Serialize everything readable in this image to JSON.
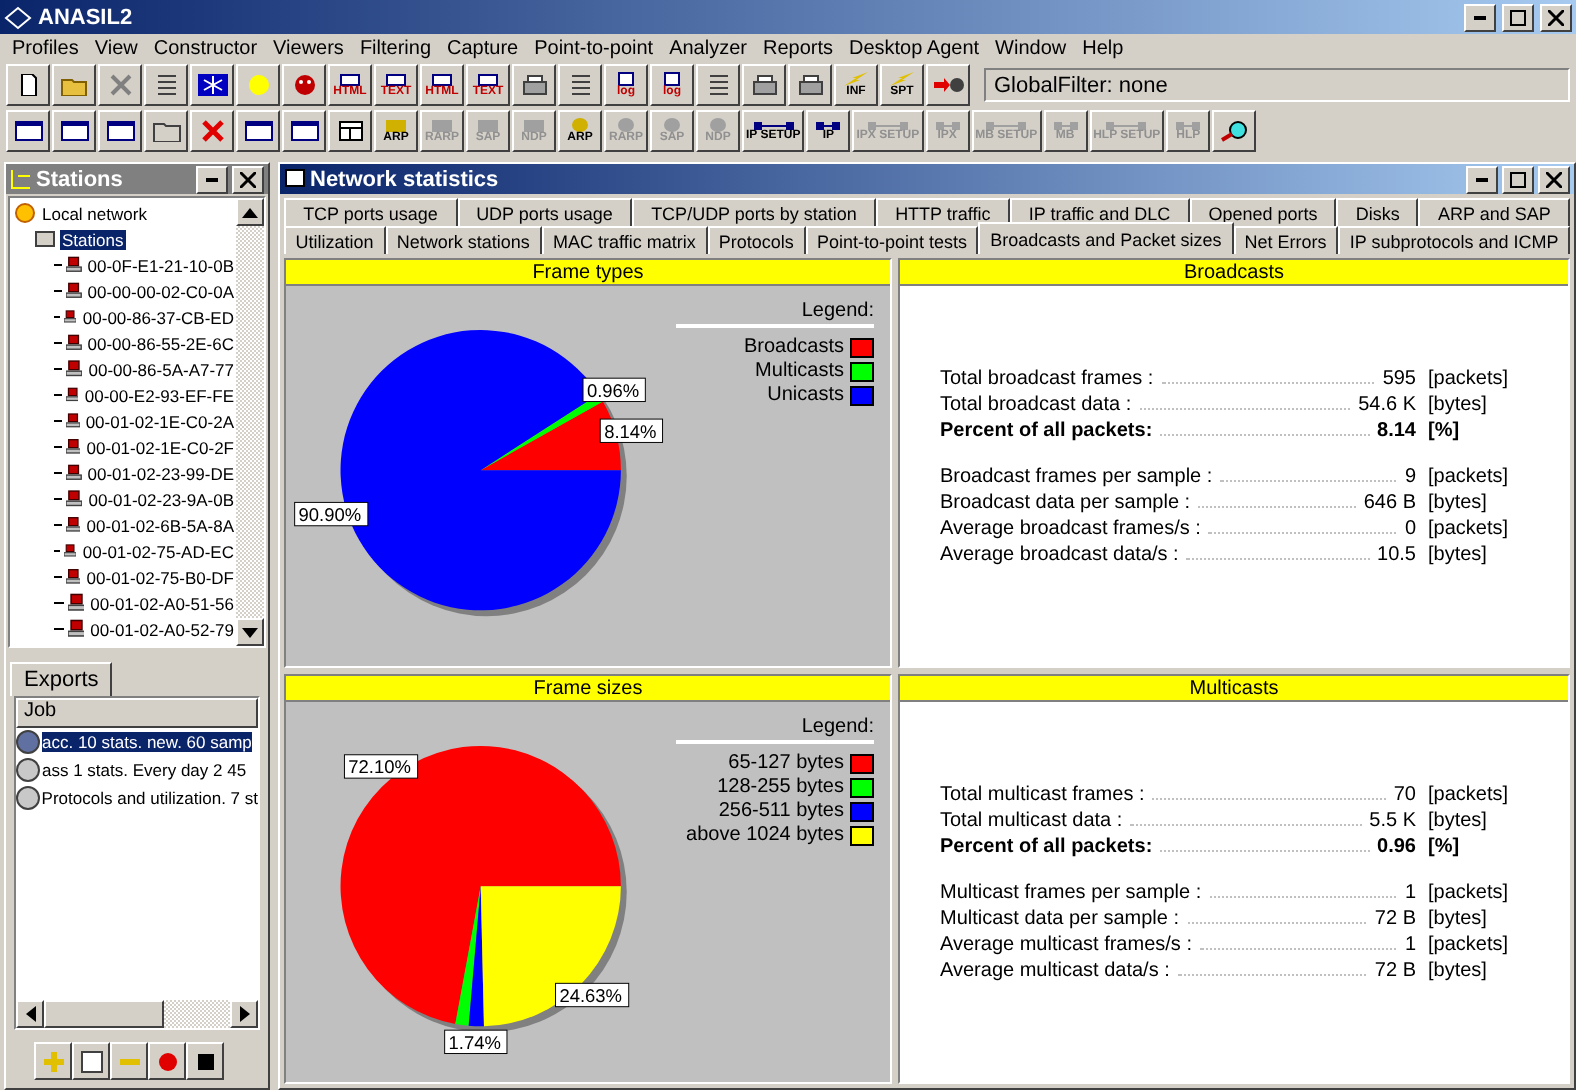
{
  "window": {
    "title": "ANASIL2"
  },
  "menu": [
    "Profiles",
    "View",
    "Constructor",
    "Viewers",
    "Filtering",
    "Capture",
    "Point-to-point",
    "Analyzer",
    "Reports",
    "Desktop Agent",
    "Window",
    "Help"
  ],
  "toolbar_rows": [
    [
      {
        "kind": "new"
      },
      {
        "kind": "open"
      },
      {
        "kind": "delete"
      },
      {
        "kind": "list"
      },
      {
        "kind": "snow"
      },
      {
        "kind": "sun"
      },
      {
        "kind": "face"
      },
      {
        "kind": "doc",
        "label": "HTML"
      },
      {
        "kind": "doc",
        "label": "TEXT"
      },
      {
        "kind": "doc",
        "label": "HTML"
      },
      {
        "kind": "doc",
        "label": "TEXT"
      },
      {
        "kind": "scanner"
      },
      {
        "kind": "tree"
      },
      {
        "kind": "log",
        "label": "log"
      },
      {
        "kind": "log",
        "label": "log"
      },
      {
        "kind": "split"
      },
      {
        "kind": "disk"
      },
      {
        "kind": "printer"
      },
      {
        "kind": "bolt",
        "label": "INF"
      },
      {
        "kind": "bolt",
        "label": "SPT"
      },
      {
        "kind": "arrow"
      }
    ],
    [
      {
        "kind": "window"
      },
      {
        "kind": "window"
      },
      {
        "kind": "window"
      },
      {
        "kind": "folder"
      },
      {
        "kind": "redx"
      },
      {
        "kind": "window"
      },
      {
        "kind": "window"
      },
      {
        "kind": "table"
      },
      {
        "kind": "query",
        "label": "ARP",
        "disabled": false
      },
      {
        "kind": "query",
        "label": "RARP",
        "disabled": true
      },
      {
        "kind": "query",
        "label": "SAP",
        "disabled": true
      },
      {
        "kind": "query",
        "label": "NDP",
        "disabled": true
      },
      {
        "kind": "bug",
        "label": "ARP",
        "disabled": false
      },
      {
        "kind": "bug",
        "label": "RARP",
        "disabled": true
      },
      {
        "kind": "bug",
        "label": "SAP",
        "disabled": true
      },
      {
        "kind": "bug",
        "label": "NDP",
        "disabled": true
      },
      {
        "kind": "setup",
        "label": "IP SETUP",
        "disabled": false
      },
      {
        "kind": "net",
        "label": "IP",
        "disabled": false
      },
      {
        "kind": "setup",
        "label": "IPX SETUP",
        "disabled": true
      },
      {
        "kind": "net",
        "label": "IPX",
        "disabled": true
      },
      {
        "kind": "setup",
        "label": "MB SETUP",
        "disabled": true
      },
      {
        "kind": "net",
        "label": "MB",
        "disabled": true
      },
      {
        "kind": "setup",
        "label": "HLP SETUP",
        "disabled": true
      },
      {
        "kind": "net",
        "label": "HLP",
        "disabled": true
      },
      {
        "kind": "magnifier"
      }
    ]
  ],
  "global_filter": {
    "value": "GlobalFilter: none"
  },
  "stations_panel": {
    "title": "Stations",
    "tree": [
      {
        "label": "Local network",
        "selected": false,
        "children": [
          {
            "label": "Stations",
            "selected": true,
            "children": [
              {
                "label": "00-0F-E1-21-10-0B"
              },
              {
                "label": "00-00-00-02-C0-0A"
              },
              {
                "label": "00-00-86-37-CB-ED"
              },
              {
                "label": "00-00-86-55-2E-6C"
              },
              {
                "label": "00-00-86-5A-A7-77"
              },
              {
                "label": "00-00-E2-93-EF-FE"
              },
              {
                "label": "00-01-02-1E-C0-2A"
              },
              {
                "label": "00-01-02-1E-C0-2F"
              },
              {
                "label": "00-01-02-23-99-DE"
              },
              {
                "label": "00-01-02-23-9A-0B"
              },
              {
                "label": "00-01-02-6B-5A-8A"
              },
              {
                "label": "00-01-02-75-AD-EC"
              },
              {
                "label": "00-01-02-75-B0-DF"
              },
              {
                "label": "00-01-02-A0-51-56"
              },
              {
                "label": "00-01-02-A0-52-79"
              }
            ]
          }
        ]
      }
    ]
  },
  "exports": {
    "tab": "Exports",
    "column": "Job",
    "rows": [
      {
        "label": "acc. 10 stats. new. 60 samp",
        "selected": true
      },
      {
        "label": "ass 1 stats. Every day 2 45",
        "selected": false
      },
      {
        "label": "Protocols and utilization. 7 st",
        "selected": false
      }
    ]
  },
  "statistics_window": {
    "title": "Network statistics",
    "tab_rows": [
      [
        {
          "label": "TCP ports usage",
          "selected": false
        },
        {
          "label": "UDP ports usage",
          "selected": false
        },
        {
          "label": "TCP/UDP ports by station",
          "selected": false
        },
        {
          "label": "HTTP traffic",
          "selected": false
        },
        {
          "label": "IP traffic and DLC",
          "selected": false
        },
        {
          "label": "Opened ports",
          "selected": false
        },
        {
          "label": "Disks",
          "selected": false
        },
        {
          "label": "ARP and SAP",
          "selected": false
        }
      ],
      [
        {
          "label": "Utilization",
          "selected": false
        },
        {
          "label": "Network stations",
          "selected": false
        },
        {
          "label": "MAC traffic matrix",
          "selected": false
        },
        {
          "label": "Protocols",
          "selected": false
        },
        {
          "label": "Point-to-point tests",
          "selected": false
        },
        {
          "label": "Broadcasts and Packet sizes",
          "selected": true
        },
        {
          "label": "Net Errors",
          "selected": false
        },
        {
          "label": "IP subprotocols and ICMP",
          "selected": false
        }
      ]
    ],
    "panels": [
      {
        "kind": "pie",
        "title": "Frame types",
        "legend": {
          "title": "Legend:",
          "items": [
            {
              "label": "Broadcasts",
              "color": "#ff0000"
            },
            {
              "label": "Multicasts",
              "color": "#00ff00"
            },
            {
              "label": "Unicasts",
              "color": "#0000ff"
            }
          ]
        },
        "chart_data": {
          "type": "pie",
          "values": [
            8.14,
            0.96,
            90.9
          ],
          "value_labels": [
            "8.14%",
            "0.96%",
            "90.90%"
          ]
        }
      },
      {
        "kind": "stats",
        "title": "Broadcasts",
        "groups": [
          [
            {
              "label": "Total broadcast frames :",
              "value": "595",
              "unit": "[packets]",
              "bold": false
            },
            {
              "label": "Total broadcast data :",
              "value": "54.6 K",
              "unit": "[bytes]",
              "bold": false
            },
            {
              "label": "Percent of all packets:",
              "value": "8.14",
              "unit": "[%]",
              "bold": true
            }
          ],
          [
            {
              "label": "Broadcast frames per sample :",
              "value": "9",
              "unit": "[packets]",
              "bold": false
            },
            {
              "label": "Broadcast data per sample :",
              "value": "646 B",
              "unit": "[bytes]",
              "bold": false
            },
            {
              "label": "Average broadcast frames/s :",
              "value": "0",
              "unit": "[packets]",
              "bold": false
            },
            {
              "label": "Average broadcast data/s :",
              "value": "10.5",
              "unit": "[bytes]",
              "bold": false
            }
          ]
        ]
      },
      {
        "kind": "pie",
        "title": "Frame sizes",
        "legend": {
          "title": "Legend:",
          "items": [
            {
              "label": "65-127 bytes",
              "color": "#ff0000"
            },
            {
              "label": "128-255 bytes",
              "color": "#00ff00"
            },
            {
              "label": "256-511 bytes",
              "color": "#0000ff"
            },
            {
              "label": "above 1024 bytes",
              "color": "#ffff00"
            }
          ]
        },
        "chart_data": {
          "type": "pie",
          "values": [
            72.1,
            1.53,
            1.74,
            24.63
          ],
          "value_labels": [
            "72.10%",
            null,
            "1.74%",
            "24.63%"
          ]
        }
      },
      {
        "kind": "stats",
        "title": "Multicasts",
        "groups": [
          [
            {
              "label": "Total multicast frames :",
              "value": "70",
              "unit": "[packets]",
              "bold": false
            },
            {
              "label": "Total multicast data :",
              "value": "5.5 K",
              "unit": "[bytes]",
              "bold": false
            },
            {
              "label": "Percent of all packets:",
              "value": "0.96",
              "unit": "[%]",
              "bold": true
            }
          ],
          [
            {
              "label": "Multicast frames per sample :",
              "value": "1",
              "unit": "[packets]",
              "bold": false
            },
            {
              "label": "Multicast data per sample :",
              "value": "72 B",
              "unit": "[bytes]",
              "bold": false
            },
            {
              "label": "Average multicast frames/s :",
              "value": "1",
              "unit": "[packets]",
              "bold": false
            },
            {
              "label": "Average multicast data/s :",
              "value": "72 B",
              "unit": "[bytes]",
              "bold": false
            }
          ]
        ]
      }
    ]
  }
}
